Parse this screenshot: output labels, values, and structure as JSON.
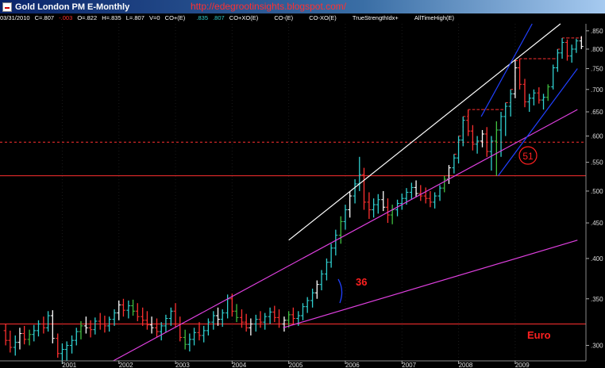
{
  "window": {
    "title": "Gold London PM E-Monthly",
    "blog_url": "http://edegrootinsights.blogspot.com/"
  },
  "infobar": {
    "date": "03/31/2010",
    "close": "C=.807",
    "change": "-.003",
    "open": "O=.822",
    "high": "H=.835",
    "low": "L=.807",
    "volume": "V=0",
    "ind1_name": "CO+(E)",
    "ind1_v1": ".835",
    "ind1_v2": ".807",
    "ind2_name": "CO+XO(E)",
    "ind3_name": "CO-(E)",
    "ind4_name": "CO-XO(E)",
    "ind5_name": "TrueStrengthIdx+",
    "ind6_name": "AllTimeHigh(E)"
  },
  "colors": {
    "background": "#000000",
    "bull_bar": "#30d0d0",
    "bear_bar": "#ff3030",
    "neutral_bar": "#ffffff",
    "green_bar": "#40c040",
    "trend_white": "#ffffff",
    "trend_magenta": "#e040e0",
    "trend_blue": "#2040ff",
    "support_red": "#ff3030",
    "annotation_red": "#ff2020"
  },
  "chart_data": {
    "type": "bar",
    "series_kind": "monthly OHLC bars (log scale)",
    "x_ticks": [
      "2001",
      "2002",
      "2003",
      "2004",
      "2005",
      "2006",
      "2007",
      "2008",
      "2009"
    ],
    "y_ticks": [
      300,
      350,
      400,
      450,
      500,
      550,
      600,
      650,
      700,
      750,
      800,
      850
    ],
    "y_scale": "log",
    "ylim": [
      285,
      870
    ],
    "annotations": {
      "angle_label": "36",
      "circled_label": "51",
      "currency_label": "Euro"
    },
    "horizontal_levels": [
      {
        "value": 322,
        "style": "solid",
        "color": "#ff3030"
      },
      {
        "value": 526,
        "style": "solid",
        "color": "#ff3030"
      },
      {
        "value": 588,
        "style": "dashed",
        "color": "#ff3030"
      }
    ],
    "trendlines": [
      {
        "color": "#ffffff",
        "from": [
          "2005.0",
          425
        ],
        "to": [
          "2009.8",
          870
        ]
      },
      {
        "color": "#e040e0",
        "from": [
          "2001.9",
          285
        ],
        "to": [
          "2010.1",
          655
        ]
      },
      {
        "color": "#e040e0",
        "from": [
          "2004.9",
          318
        ],
        "to": [
          "2010.1",
          425
        ]
      },
      {
        "color": "#2040ff",
        "from": [
          "2008.7",
          526
        ],
        "to": [
          "2010.1",
          750
        ]
      },
      {
        "color": "#2040ff",
        "from": [
          "2008.4",
          640
        ],
        "to": [
          "2009.3",
          870
        ]
      }
    ],
    "ohlc": [
      {
        "t": 2000.0,
        "o": 315,
        "h": 322,
        "l": 300,
        "c": 305
      },
      {
        "t": 2000.08,
        "o": 305,
        "h": 315,
        "l": 293,
        "c": 298
      },
      {
        "t": 2000.17,
        "o": 298,
        "h": 310,
        "l": 290,
        "c": 303
      },
      {
        "t": 2000.25,
        "o": 303,
        "h": 318,
        "l": 296,
        "c": 312
      },
      {
        "t": 2000.33,
        "o": 312,
        "h": 320,
        "l": 301,
        "c": 306
      },
      {
        "t": 2000.42,
        "o": 306,
        "h": 316,
        "l": 300,
        "c": 311
      },
      {
        "t": 2000.5,
        "o": 311,
        "h": 321,
        "l": 304,
        "c": 315
      },
      {
        "t": 2000.58,
        "o": 315,
        "h": 326,
        "l": 309,
        "c": 322
      },
      {
        "t": 2000.67,
        "o": 322,
        "h": 330,
        "l": 312,
        "c": 318
      },
      {
        "t": 2000.75,
        "o": 318,
        "h": 336,
        "l": 314,
        "c": 331
      },
      {
        "t": 2000.83,
        "o": 331,
        "h": 337,
        "l": 302,
        "c": 307
      },
      {
        "t": 2000.92,
        "o": 307,
        "h": 312,
        "l": 288,
        "c": 292
      },
      {
        "t": 2001.0,
        "o": 292,
        "h": 302,
        "l": 282,
        "c": 296
      },
      {
        "t": 2001.08,
        "o": 296,
        "h": 304,
        "l": 285,
        "c": 300
      },
      {
        "t": 2001.17,
        "o": 300,
        "h": 310,
        "l": 292,
        "c": 305
      },
      {
        "t": 2001.25,
        "o": 305,
        "h": 318,
        "l": 300,
        "c": 314
      },
      {
        "t": 2001.33,
        "o": 314,
        "h": 325,
        "l": 306,
        "c": 320
      },
      {
        "t": 2001.42,
        "o": 320,
        "h": 330,
        "l": 312,
        "c": 318
      },
      {
        "t": 2001.5,
        "o": 318,
        "h": 326,
        "l": 308,
        "c": 316
      },
      {
        "t": 2001.58,
        "o": 316,
        "h": 329,
        "l": 311,
        "c": 325
      },
      {
        "t": 2001.67,
        "o": 325,
        "h": 334,
        "l": 316,
        "c": 322
      },
      {
        "t": 2001.75,
        "o": 322,
        "h": 331,
        "l": 313,
        "c": 320
      },
      {
        "t": 2001.83,
        "o": 320,
        "h": 330,
        "l": 314,
        "c": 327
      },
      {
        "t": 2001.92,
        "o": 327,
        "h": 338,
        "l": 320,
        "c": 334
      },
      {
        "t": 2002.0,
        "o": 334,
        "h": 348,
        "l": 326,
        "c": 343
      },
      {
        "t": 2002.08,
        "o": 343,
        "h": 350,
        "l": 330,
        "c": 337
      },
      {
        "t": 2002.17,
        "o": 337,
        "h": 348,
        "l": 328,
        "c": 342
      },
      {
        "t": 2002.25,
        "o": 342,
        "h": 349,
        "l": 331,
        "c": 336
      },
      {
        "t": 2002.33,
        "o": 336,
        "h": 345,
        "l": 325,
        "c": 330
      },
      {
        "t": 2002.42,
        "o": 330,
        "h": 340,
        "l": 320,
        "c": 326
      },
      {
        "t": 2002.5,
        "o": 326,
        "h": 336,
        "l": 316,
        "c": 321
      },
      {
        "t": 2002.58,
        "o": 321,
        "h": 330,
        "l": 312,
        "c": 318
      },
      {
        "t": 2002.67,
        "o": 318,
        "h": 328,
        "l": 308,
        "c": 314
      },
      {
        "t": 2002.75,
        "o": 314,
        "h": 324,
        "l": 305,
        "c": 320
      },
      {
        "t": 2002.83,
        "o": 320,
        "h": 332,
        "l": 313,
        "c": 328
      },
      {
        "t": 2002.92,
        "o": 328,
        "h": 340,
        "l": 320,
        "c": 336
      },
      {
        "t": 2003.0,
        "o": 336,
        "h": 345,
        "l": 318,
        "c": 322
      },
      {
        "t": 2003.08,
        "o": 322,
        "h": 330,
        "l": 304,
        "c": 308
      },
      {
        "t": 2003.17,
        "o": 308,
        "h": 316,
        "l": 296,
        "c": 301
      },
      {
        "t": 2003.25,
        "o": 301,
        "h": 312,
        "l": 294,
        "c": 306
      },
      {
        "t": 2003.33,
        "o": 306,
        "h": 318,
        "l": 300,
        "c": 313
      },
      {
        "t": 2003.42,
        "o": 313,
        "h": 324,
        "l": 305,
        "c": 310
      },
      {
        "t": 2003.5,
        "o": 310,
        "h": 320,
        "l": 303,
        "c": 315
      },
      {
        "t": 2003.58,
        "o": 315,
        "h": 328,
        "l": 310,
        "c": 324
      },
      {
        "t": 2003.67,
        "o": 324,
        "h": 336,
        "l": 316,
        "c": 331
      },
      {
        "t": 2003.75,
        "o": 331,
        "h": 340,
        "l": 320,
        "c": 327
      },
      {
        "t": 2003.83,
        "o": 327,
        "h": 338,
        "l": 319,
        "c": 334
      },
      {
        "t": 2003.92,
        "o": 334,
        "h": 355,
        "l": 328,
        "c": 350
      },
      {
        "t": 2004.0,
        "o": 350,
        "h": 356,
        "l": 330,
        "c": 336
      },
      {
        "t": 2004.08,
        "o": 336,
        "h": 344,
        "l": 324,
        "c": 329
      },
      {
        "t": 2004.17,
        "o": 329,
        "h": 338,
        "l": 318,
        "c": 324
      },
      {
        "t": 2004.25,
        "o": 324,
        "h": 333,
        "l": 314,
        "c": 318
      },
      {
        "t": 2004.33,
        "o": 318,
        "h": 328,
        "l": 310,
        "c": 322
      },
      {
        "t": 2004.42,
        "o": 322,
        "h": 332,
        "l": 314,
        "c": 327
      },
      {
        "t": 2004.5,
        "o": 327,
        "h": 336,
        "l": 318,
        "c": 324
      },
      {
        "t": 2004.58,
        "o": 324,
        "h": 334,
        "l": 316,
        "c": 330
      },
      {
        "t": 2004.67,
        "o": 330,
        "h": 340,
        "l": 322,
        "c": 335
      },
      {
        "t": 2004.75,
        "o": 335,
        "h": 342,
        "l": 324,
        "c": 329
      },
      {
        "t": 2004.83,
        "o": 329,
        "h": 338,
        "l": 318,
        "c": 322
      },
      {
        "t": 2004.92,
        "o": 322,
        "h": 330,
        "l": 314,
        "c": 326
      },
      {
        "t": 2005.0,
        "o": 326,
        "h": 336,
        "l": 318,
        "c": 332
      },
      {
        "t": 2005.08,
        "o": 332,
        "h": 340,
        "l": 322,
        "c": 328
      },
      {
        "t": 2005.17,
        "o": 328,
        "h": 336,
        "l": 320,
        "c": 331
      },
      {
        "t": 2005.25,
        "o": 331,
        "h": 345,
        "l": 326,
        "c": 341
      },
      {
        "t": 2005.33,
        "o": 341,
        "h": 352,
        "l": 334,
        "c": 348
      },
      {
        "t": 2005.42,
        "o": 348,
        "h": 362,
        "l": 340,
        "c": 357
      },
      {
        "t": 2005.5,
        "o": 357,
        "h": 372,
        "l": 350,
        "c": 367
      },
      {
        "t": 2005.58,
        "o": 367,
        "h": 385,
        "l": 360,
        "c": 380
      },
      {
        "t": 2005.67,
        "o": 380,
        "h": 400,
        "l": 372,
        "c": 395
      },
      {
        "t": 2005.75,
        "o": 395,
        "h": 420,
        "l": 388,
        "c": 414
      },
      {
        "t": 2005.83,
        "o": 414,
        "h": 440,
        "l": 404,
        "c": 432
      },
      {
        "t": 2005.92,
        "o": 432,
        "h": 460,
        "l": 420,
        "c": 452
      },
      {
        "t": 2006.0,
        "o": 452,
        "h": 478,
        "l": 440,
        "c": 470
      },
      {
        "t": 2006.08,
        "o": 470,
        "h": 500,
        "l": 458,
        "c": 492
      },
      {
        "t": 2006.17,
        "o": 492,
        "h": 520,
        "l": 480,
        "c": 512
      },
      {
        "t": 2006.25,
        "o": 512,
        "h": 560,
        "l": 500,
        "c": 528
      },
      {
        "t": 2006.33,
        "o": 528,
        "h": 540,
        "l": 470,
        "c": 482
      },
      {
        "t": 2006.42,
        "o": 482,
        "h": 498,
        "l": 456,
        "c": 470
      },
      {
        "t": 2006.5,
        "o": 470,
        "h": 488,
        "l": 458,
        "c": 478
      },
      {
        "t": 2006.58,
        "o": 478,
        "h": 495,
        "l": 464,
        "c": 486
      },
      {
        "t": 2006.67,
        "o": 486,
        "h": 500,
        "l": 468,
        "c": 474
      },
      {
        "t": 2006.75,
        "o": 474,
        "h": 488,
        "l": 450,
        "c": 462
      },
      {
        "t": 2006.83,
        "o": 462,
        "h": 478,
        "l": 448,
        "c": 470
      },
      {
        "t": 2006.92,
        "o": 470,
        "h": 486,
        "l": 460,
        "c": 480
      },
      {
        "t": 2007.0,
        "o": 480,
        "h": 496,
        "l": 470,
        "c": 488
      },
      {
        "t": 2007.08,
        "o": 488,
        "h": 505,
        "l": 478,
        "c": 498
      },
      {
        "t": 2007.17,
        "o": 498,
        "h": 514,
        "l": 486,
        "c": 506
      },
      {
        "t": 2007.25,
        "o": 506,
        "h": 518,
        "l": 490,
        "c": 496
      },
      {
        "t": 2007.33,
        "o": 496,
        "h": 510,
        "l": 484,
        "c": 492
      },
      {
        "t": 2007.42,
        "o": 492,
        "h": 506,
        "l": 480,
        "c": 488
      },
      {
        "t": 2007.5,
        "o": 488,
        "h": 500,
        "l": 474,
        "c": 482
      },
      {
        "t": 2007.58,
        "o": 482,
        "h": 498,
        "l": 472,
        "c": 492
      },
      {
        "t": 2007.67,
        "o": 492,
        "h": 510,
        "l": 484,
        "c": 505
      },
      {
        "t": 2007.75,
        "o": 505,
        "h": 526,
        "l": 498,
        "c": 520
      },
      {
        "t": 2007.83,
        "o": 520,
        "h": 545,
        "l": 512,
        "c": 540
      },
      {
        "t": 2007.92,
        "o": 540,
        "h": 565,
        "l": 530,
        "c": 558
      },
      {
        "t": 2008.0,
        "o": 558,
        "h": 600,
        "l": 548,
        "c": 592
      },
      {
        "t": 2008.08,
        "o": 592,
        "h": 640,
        "l": 580,
        "c": 632
      },
      {
        "t": 2008.17,
        "o": 632,
        "h": 655,
        "l": 600,
        "c": 610
      },
      {
        "t": 2008.25,
        "o": 610,
        "h": 622,
        "l": 572,
        "c": 584
      },
      {
        "t": 2008.33,
        "o": 584,
        "h": 600,
        "l": 566,
        "c": 590
      },
      {
        "t": 2008.42,
        "o": 590,
        "h": 612,
        "l": 578,
        "c": 604
      },
      {
        "t": 2008.5,
        "o": 604,
        "h": 618,
        "l": 560,
        "c": 570
      },
      {
        "t": 2008.58,
        "o": 570,
        "h": 600,
        "l": 535,
        "c": 590
      },
      {
        "t": 2008.67,
        "o": 590,
        "h": 630,
        "l": 526,
        "c": 612
      },
      {
        "t": 2008.75,
        "o": 612,
        "h": 650,
        "l": 560,
        "c": 640
      },
      {
        "t": 2008.83,
        "o": 640,
        "h": 670,
        "l": 600,
        "c": 662
      },
      {
        "t": 2008.92,
        "o": 662,
        "h": 700,
        "l": 640,
        "c": 690
      },
      {
        "t": 2009.0,
        "o": 690,
        "h": 770,
        "l": 680,
        "c": 752
      },
      {
        "t": 2009.08,
        "o": 752,
        "h": 775,
        "l": 700,
        "c": 712
      },
      {
        "t": 2009.17,
        "o": 712,
        "h": 725,
        "l": 660,
        "c": 672
      },
      {
        "t": 2009.25,
        "o": 672,
        "h": 690,
        "l": 650,
        "c": 680
      },
      {
        "t": 2009.33,
        "o": 680,
        "h": 700,
        "l": 664,
        "c": 692
      },
      {
        "t": 2009.42,
        "o": 692,
        "h": 705,
        "l": 668,
        "c": 676
      },
      {
        "t": 2009.5,
        "o": 676,
        "h": 690,
        "l": 655,
        "c": 682
      },
      {
        "t": 2009.58,
        "o": 682,
        "h": 712,
        "l": 674,
        "c": 706
      },
      {
        "t": 2009.67,
        "o": 706,
        "h": 760,
        "l": 700,
        "c": 752
      },
      {
        "t": 2009.75,
        "o": 752,
        "h": 800,
        "l": 742,
        "c": 790
      },
      {
        "t": 2009.83,
        "o": 790,
        "h": 830,
        "l": 775,
        "c": 818
      },
      {
        "t": 2009.92,
        "o": 818,
        "h": 826,
        "l": 770,
        "c": 782
      },
      {
        "t": 2010.0,
        "o": 782,
        "h": 812,
        "l": 765,
        "c": 800
      },
      {
        "t": 2010.08,
        "o": 800,
        "h": 828,
        "l": 790,
        "c": 822
      },
      {
        "t": 2010.17,
        "o": 822,
        "h": 835,
        "l": 800,
        "c": 807
      }
    ]
  }
}
